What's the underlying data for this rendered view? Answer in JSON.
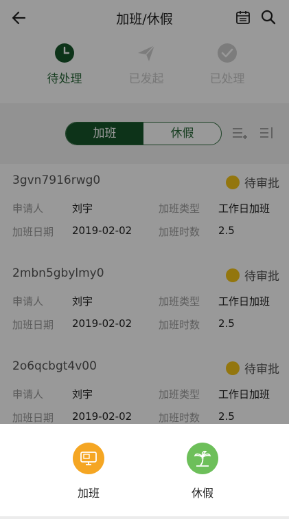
{
  "header": {
    "title": "加班/休假"
  },
  "status_tabs": [
    {
      "label": "待处理",
      "icon": "clock-icon"
    },
    {
      "label": "已发起",
      "icon": "paper-plane-icon"
    },
    {
      "label": "已处理",
      "icon": "check-circle-icon"
    }
  ],
  "segment": {
    "options": [
      "加班",
      "休假"
    ],
    "selected": "加班"
  },
  "cards": [
    {
      "code": "3gvn7916rwg0",
      "status": "待审批",
      "applicant_label": "申请人",
      "applicant": "刘宇",
      "type_label": "加班类型",
      "type": "工作日加班",
      "date_label": "加班日期",
      "date": "2019-02-02",
      "hours_label": "加班时数",
      "hours": "2.5"
    },
    {
      "code": "2mbn5gbylmy0",
      "status": "待审批",
      "applicant_label": "申请人",
      "applicant": "刘宇",
      "type_label": "加班类型",
      "type": "工作日加班",
      "date_label": "加班日期",
      "date": "2019-02-02",
      "hours_label": "加班时数",
      "hours": "2.5"
    },
    {
      "code": "2o6qcbgt4v00",
      "status": "待审批",
      "applicant_label": "申请人",
      "applicant": "刘宇",
      "type_label": "加班类型",
      "type": "工作日加班",
      "date_label": "加班日期",
      "date": "2019-02-02",
      "hours_label": "加班时数",
      "hours": "2.5"
    }
  ],
  "action_sheet": {
    "items": [
      {
        "label": "加班",
        "icon": "monitor-icon",
        "color": "#f5a623"
      },
      {
        "label": "休假",
        "icon": "palm-tree-icon",
        "color": "#6dbf5a"
      }
    ]
  },
  "colors": {
    "accent": "#17562b",
    "pending": "#f5c518"
  }
}
